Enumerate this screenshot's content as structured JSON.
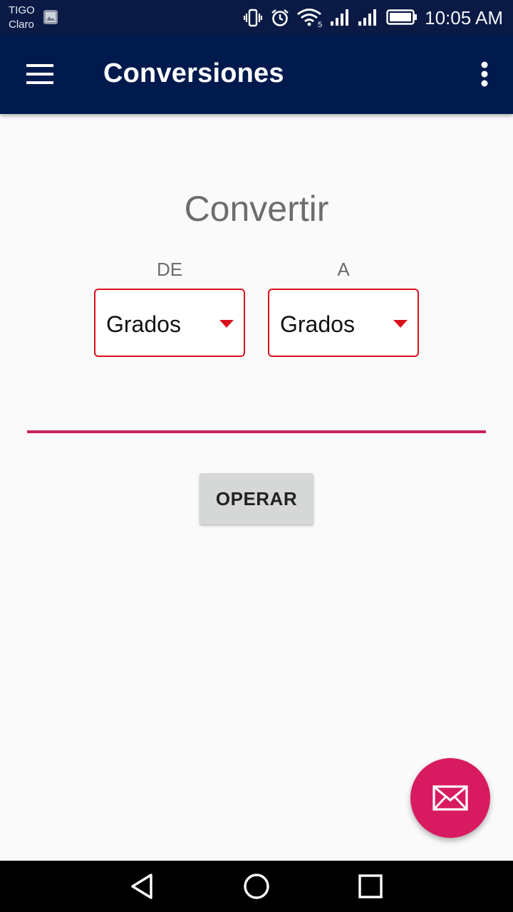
{
  "status_bar": {
    "carrier_1": "TIGO",
    "carrier_2": "Claro",
    "time": "10:05 AM",
    "icons": [
      "gallery-icon",
      "vibrate-icon",
      "alarm-icon",
      "wifi-icon",
      "signal-icon",
      "signal-icon",
      "battery-icon"
    ]
  },
  "app_bar": {
    "title": "Conversiones",
    "menu_icon": "hamburger-menu-icon",
    "overflow_icon": "more-vert-icon",
    "color": "#001a4d"
  },
  "main": {
    "heading": "Convertir",
    "from_label": "DE",
    "to_label": "A",
    "from_value": "Grados",
    "to_value": "Grados",
    "input_value": "",
    "operate_label": "OPERAR",
    "accent_color": "#d8121c",
    "underline_color": "#c8215a"
  },
  "fab": {
    "icon": "mail-icon",
    "color": "#d81b60"
  },
  "nav_bar": {
    "icons": [
      "back-icon",
      "home-icon",
      "recents-icon"
    ]
  }
}
